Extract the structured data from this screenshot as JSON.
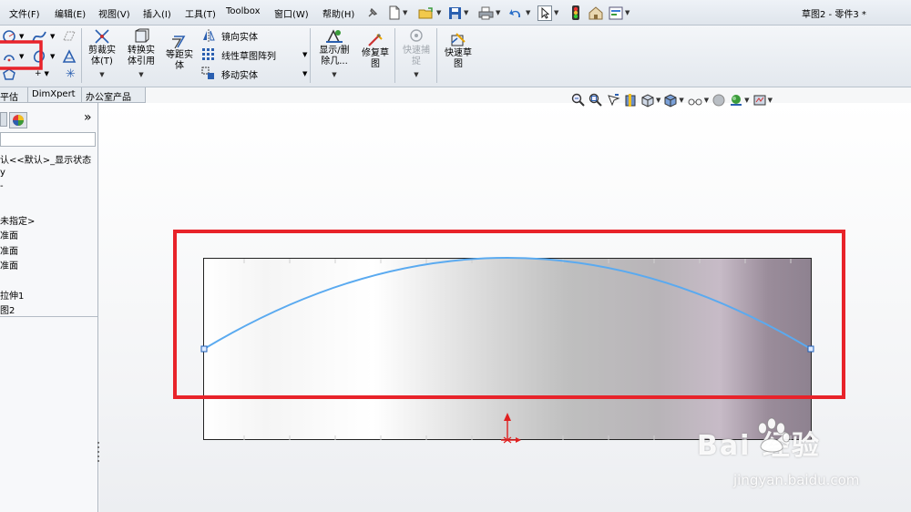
{
  "menu": {
    "items": [
      "文件(F)",
      "编辑(E)",
      "视图(V)",
      "插入(I)",
      "工具(T)",
      "Toolbox",
      "窗口(W)",
      "帮助(H)"
    ]
  },
  "window": {
    "title": "草图2 - 零件3 *"
  },
  "command_manager": {
    "trim_label": "剪裁实\n体(T)",
    "convert_label": "转换实\n体引用",
    "offset_label": "等距实\n体",
    "mirror_label": "镜向实体",
    "pattern_label": "线性草图阵列",
    "move_label": "移动实体",
    "display_delete_label": "显示/删\n除几...",
    "repair_label": "修复草\n图",
    "quick_snap_label": "快速捕\n捉",
    "rapid_sketch_label": "快速草\n图"
  },
  "tabs": [
    "平估",
    "DimXpert",
    "办公室产品"
  ],
  "tree": {
    "items": [
      "认<<默认>_显示状态",
      "y",
      "-",
      "未指定>",
      "准面",
      "准面",
      "准面",
      "拉伸1",
      "图2"
    ]
  },
  "watermark": {
    "logo": "Bai 经验",
    "url": "jingyan.baidu.com"
  },
  "colors": {
    "highlight": "#e8232a",
    "sketch": "#5aaaf0",
    "origin": "#e02020"
  }
}
